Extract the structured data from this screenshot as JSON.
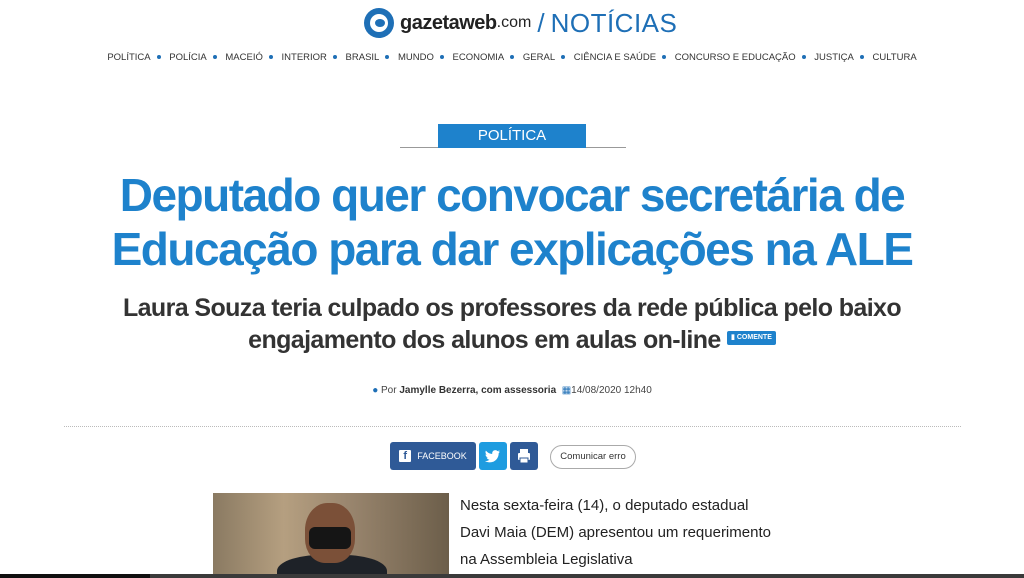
{
  "header": {
    "logo_name": "gazetaweb",
    "logo_domain": ".com",
    "logo_separator": "/",
    "section": "NOTÍCIAS"
  },
  "nav": [
    "POLÍTICA",
    "POLÍCIA",
    "MACEIÓ",
    "INTERIOR",
    "BRASIL",
    "MUNDO",
    "ECONOMIA",
    "GERAL",
    "CIÊNCIA E SAÚDE",
    "CONCURSO E EDUCAÇÃO",
    "JUSTIÇA",
    "CULTURA"
  ],
  "article": {
    "category": "POLÍTICA",
    "headline": "Deputado quer convocar secretária de Educação para dar explicações na ALE",
    "subheadline": "Laura Souza teria culpado os professores da rede pública pelo baixo engajamento dos alunos em aulas on-line",
    "comment_badge": "COMENTE",
    "byline_prefix": "Por",
    "author": "Jamylle Bezerra, com assessoria",
    "date": "14/08/2020 12h40",
    "body": "Nesta sexta-feira (14), o deputado estadual Davi Maia (DEM) apresentou um requerimento na Assembleia Legislativa"
  },
  "share": {
    "facebook_label": "FACEBOOK",
    "report_error_label": "Comunicar erro"
  },
  "icons": {
    "logo": "gazetaweb-logo-icon",
    "user": "user-icon",
    "calendar": "calendar-icon",
    "comment": "comment-icon",
    "facebook": "facebook-icon",
    "twitter": "twitter-icon",
    "print": "print-icon"
  },
  "colors": {
    "brand_blue": "#1e82cc",
    "facebook_blue": "#2f5a97",
    "twitter_blue": "#1e9ce0",
    "text_dark": "#333333"
  }
}
